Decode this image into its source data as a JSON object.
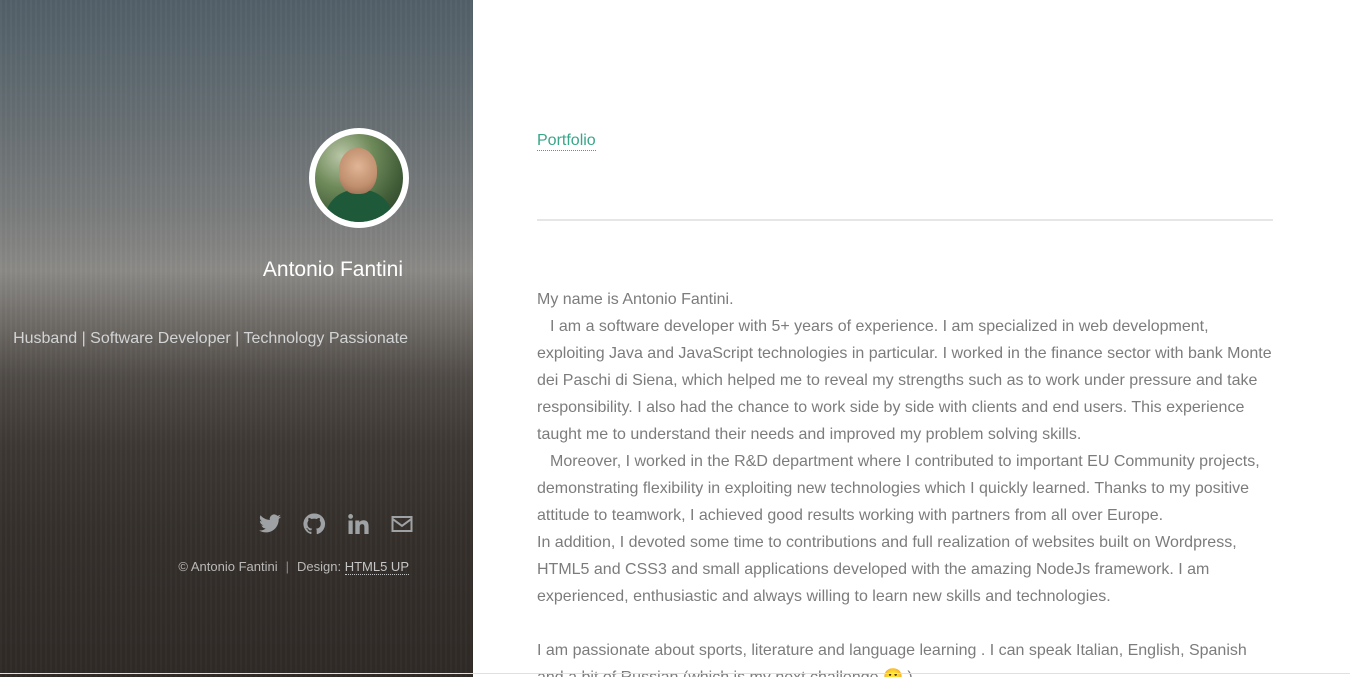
{
  "sidebar": {
    "name": "Antonio Fantini",
    "tagline": "Husband | Software Developer | Technology Passionate",
    "social": [
      "twitter-icon",
      "github-icon",
      "linkedin-icon",
      "envelope-icon"
    ],
    "copyright": "© Antonio Fantini",
    "design_label": "Design:",
    "design_link": "HTML5 UP"
  },
  "main": {
    "nav_link": "Portfolio",
    "bio": [
      "My name is Antonio Fantini.",
      "I am a software developer with 5+ years of experience. I am specialized in web development, exploiting Java and JavaScript technologies in particular. I worked in the finance sector with bank Monte dei Paschi di Siena, which helped me to reveal my strengths such as to work under pressure and take responsibility. I also had the chance to work side by side with clients and end users. This experience taught me to understand their needs and improved my problem solving skills.",
      "Moreover, I worked in the R&D department where I contributed to important EU Community projects, demonstrating flexibility in exploiting new technologies which I quickly learned. Thanks to my positive attitude to teamwork, I achieved good results working with partners from all over Europe.",
      "In addition, I devoted some time to contributions and full realization of websites built on Wordpress, HTML5 and CSS3 and small applications developed with the amazing NodeJs framework. I am experienced, enthusiastic and always willing to learn new skills and technologies.",
      "I am passionate about sports, literature and language learning . I can speak Italian, English, Spanish and a bit of Russian (which is my next challenge 🙂 )."
    ]
  },
  "colors": {
    "accent": "#3aa58a",
    "body_text": "#7c7c7c"
  }
}
